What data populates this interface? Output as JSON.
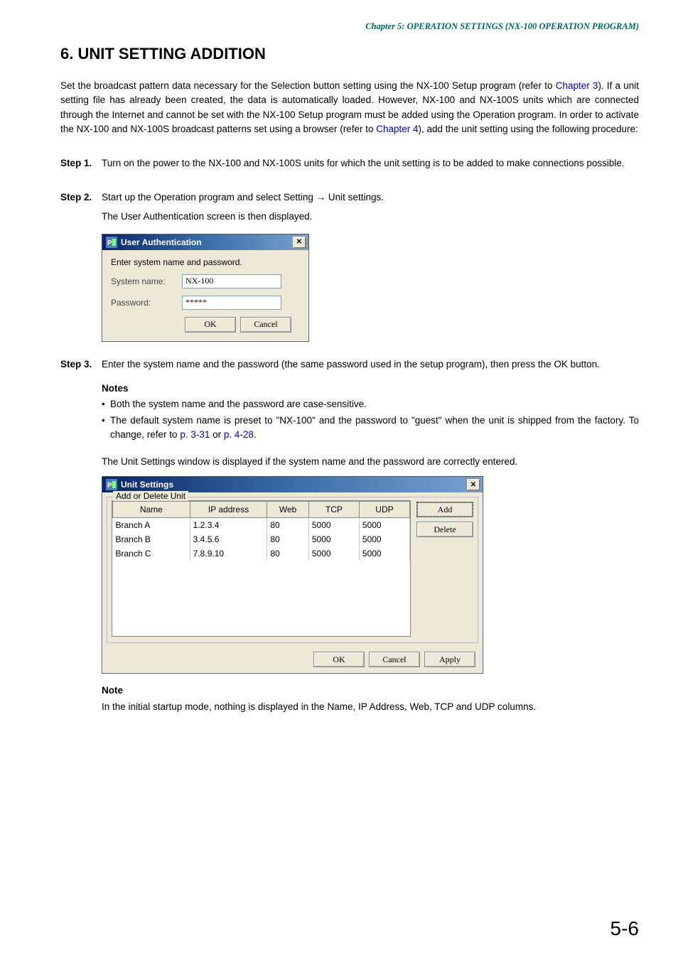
{
  "header": {
    "chapter": "Chapter 5:  OPERATION SETTINGS (NX-100 OPERATION PROGRAM)"
  },
  "section": {
    "title": "6. UNIT SETTING ADDITION"
  },
  "intro": {
    "p1a": "Set the broadcast pattern data necessary for the Selection button setting using the NX-100 Setup program (refer to ",
    "p1_link1": "Chapter 3",
    "p1b": "). If a unit setting file has already been created, the data is automatically loaded. However, NX-100 and NX-100S units which are connected through the Internet and cannot be set with the NX-100 Setup program must be added using the Operation program. In order to activate the NX-100 and NX-100S broadcast patterns set using a browser (refer to ",
    "p1_link2": "Chapter 4",
    "p1c": "), add the unit setting using the following procedure:"
  },
  "steps": {
    "s1_label": "Step 1.",
    "s1_text": "Turn on the power to the NX-100 and NX-100S units for which the unit setting is to be added to make connections possible.",
    "s2_label": "Step 2.",
    "s2_text_a": "Start up the Operation program and select Setting → Unit settings.",
    "s2_text_b": "The User Authentication screen is then displayed.",
    "s3_label": "Step 3.",
    "s3_text": "Enter the system name and the password (the same password used in the setup program), then press the OK button."
  },
  "dialog_auth": {
    "title": "User Authentication",
    "instruction": "Enter system name and password.",
    "sysname_label": "System name:",
    "sysname_value": "NX-100",
    "password_label": "Password:",
    "password_value": "*****",
    "ok": "OK",
    "cancel": "Cancel"
  },
  "notes_block": {
    "heading": "Notes",
    "b1": "Both the system name and the password are case-sensitive.",
    "b2a": "The default system name is preset to \"NX-100\" and the password to \"guest\" when the unit is shipped from the factory. To change, refer to ",
    "b2_link1": "p. 3-31",
    "b2_mid": " or ",
    "b2_link2": "p. 4-28",
    "b2c": ".",
    "after": "The Unit Settings window is displayed if the system name and the password are correctly entered."
  },
  "dialog_settings": {
    "title": "Unit Settings",
    "fieldset": "Add or Delete Unit",
    "cols": {
      "name": "Name",
      "ip": "IP address",
      "web": "Web",
      "tcp": "TCP",
      "udp": "UDP"
    },
    "rows": [
      {
        "name": "Branch A",
        "ip": "1.2.3.4",
        "web": "80",
        "tcp": "5000",
        "udp": "5000"
      },
      {
        "name": "Branch B",
        "ip": "3.4.5.6",
        "web": "80",
        "tcp": "5000",
        "udp": "5000"
      },
      {
        "name": "Branch C",
        "ip": "7.8.9.10",
        "web": "80",
        "tcp": "5000",
        "udp": "5000"
      }
    ],
    "add": "Add",
    "delete": "Delete",
    "ok": "OK",
    "cancel": "Cancel",
    "apply": "Apply"
  },
  "note2": {
    "heading": "Note",
    "text": "In the initial startup mode, nothing is displayed in the Name, IP Address, Web, TCP and UDP columns."
  },
  "page_number": "5-6"
}
